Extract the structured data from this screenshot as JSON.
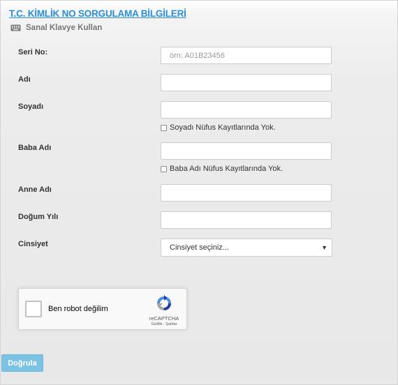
{
  "form": {
    "title": "T.C. KİMLİK NO SORGULAMA BİLGİLERİ",
    "virtual_keyboard_label": "Sanal Klavye Kullan",
    "fields": {
      "seri_no": {
        "label": "Seri No:",
        "value": "",
        "placeholder": "örn: A01B23456"
      },
      "adi": {
        "label": "Adı",
        "value": ""
      },
      "soyadi": {
        "label": "Soyadı",
        "value": "",
        "check_label": "Soyadı Nüfus Kayıtlarında Yok."
      },
      "baba_adi": {
        "label": "Baba Adı",
        "value": "",
        "check_label": "Baba Adı Nüfus Kayıtlarında Yok."
      },
      "anne_adi": {
        "label": "Anne Adı",
        "value": ""
      },
      "dogum_yili": {
        "label": "Doğum Yılı",
        "value": ""
      },
      "cinsiyet": {
        "label": "Cinsiyet",
        "selected": "Cinsiyet seçiniz..."
      }
    },
    "recaptcha": {
      "label": "Ben robot değilim",
      "brand": "reCAPTCHA",
      "links": "Gizlilik - Şartlar"
    },
    "submit_label": "Doğrula"
  },
  "colors": {
    "title": "#2a8fd6",
    "button": "#7cc3e3",
    "recaptcha_blue": "#4a90e2"
  },
  "icons": {
    "keyboard": "keyboard-icon",
    "recaptcha": "recaptcha-logo-icon",
    "dropdown": "chevron-down-icon"
  }
}
